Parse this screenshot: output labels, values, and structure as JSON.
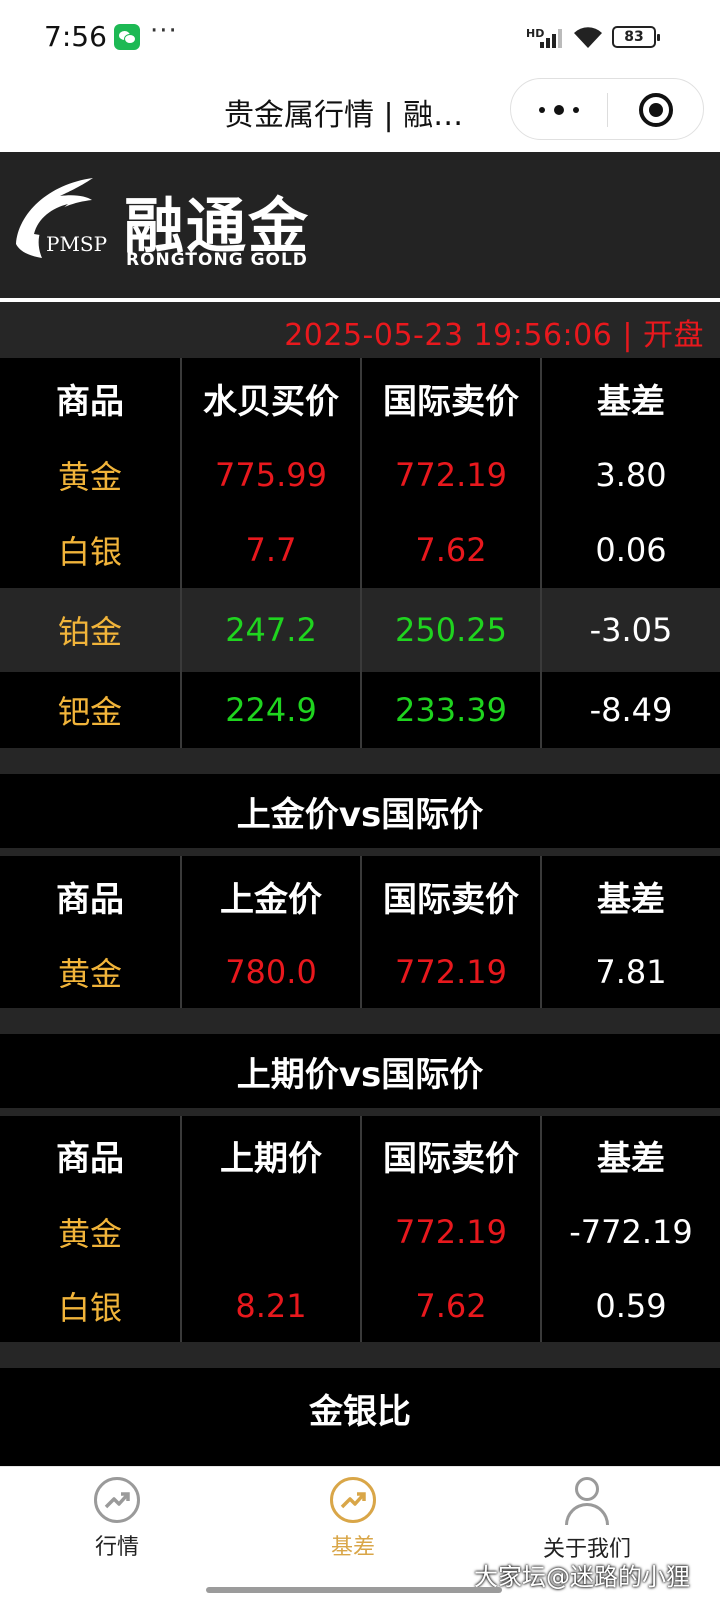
{
  "status_bar": {
    "time": "7:56",
    "more": "···",
    "network": "HD",
    "battery": "83"
  },
  "title_bar": {
    "title": "贵金属行情 | 融…"
  },
  "brand": {
    "emblem_text": "PMSP",
    "name_cn": "融通金",
    "name_en": "RONGTONG  GOLD"
  },
  "datetime": "2025-05-23 19:56:06 | 开盘",
  "table1": {
    "headers": [
      "商品",
      "水贝买价",
      "国际卖价",
      "基差"
    ],
    "rows": [
      {
        "name": "黄金",
        "buy": "775.99",
        "intl": "772.19",
        "basis": "3.80",
        "trend": "up"
      },
      {
        "name": "白银",
        "buy": "7.7",
        "intl": "7.62",
        "basis": "0.06",
        "trend": "up"
      },
      {
        "name": "铂金",
        "buy": "247.2",
        "intl": "250.25",
        "basis": "-3.05",
        "trend": "down"
      },
      {
        "name": "钯金",
        "buy": "224.9",
        "intl": "233.39",
        "basis": "-8.49",
        "trend": "down"
      }
    ]
  },
  "section2": {
    "title": "上金价vs国际价",
    "headers": [
      "商品",
      "上金价",
      "国际卖价",
      "基差"
    ],
    "rows": [
      {
        "name": "黄金",
        "price": "780.0",
        "intl": "772.19",
        "basis": "7.81"
      }
    ]
  },
  "section3": {
    "title": "上期价vs国际价",
    "headers": [
      "商品",
      "上期价",
      "国际卖价",
      "基差"
    ],
    "rows": [
      {
        "name": "黄金",
        "price": "",
        "intl": "772.19",
        "basis": "-772.19"
      },
      {
        "name": "白银",
        "price": "8.21",
        "intl": "7.62",
        "basis": "0.59"
      }
    ]
  },
  "section4": {
    "title": "金银比"
  },
  "tabbar": {
    "tabs": [
      {
        "label": "行情",
        "icon": "trend-chart-icon",
        "active": false
      },
      {
        "label": "基差",
        "icon": "trend-chart-icon",
        "active": true
      },
      {
        "label": "关于我们",
        "icon": "user-icon",
        "active": false
      }
    ]
  },
  "watermark": "大家坛@迷路的小狸",
  "colors": {
    "price_up": "#e8181d",
    "price_down": "#1fd41f",
    "product": "#f1b43a",
    "tab_active": "#d9a648",
    "background": "#000000"
  }
}
